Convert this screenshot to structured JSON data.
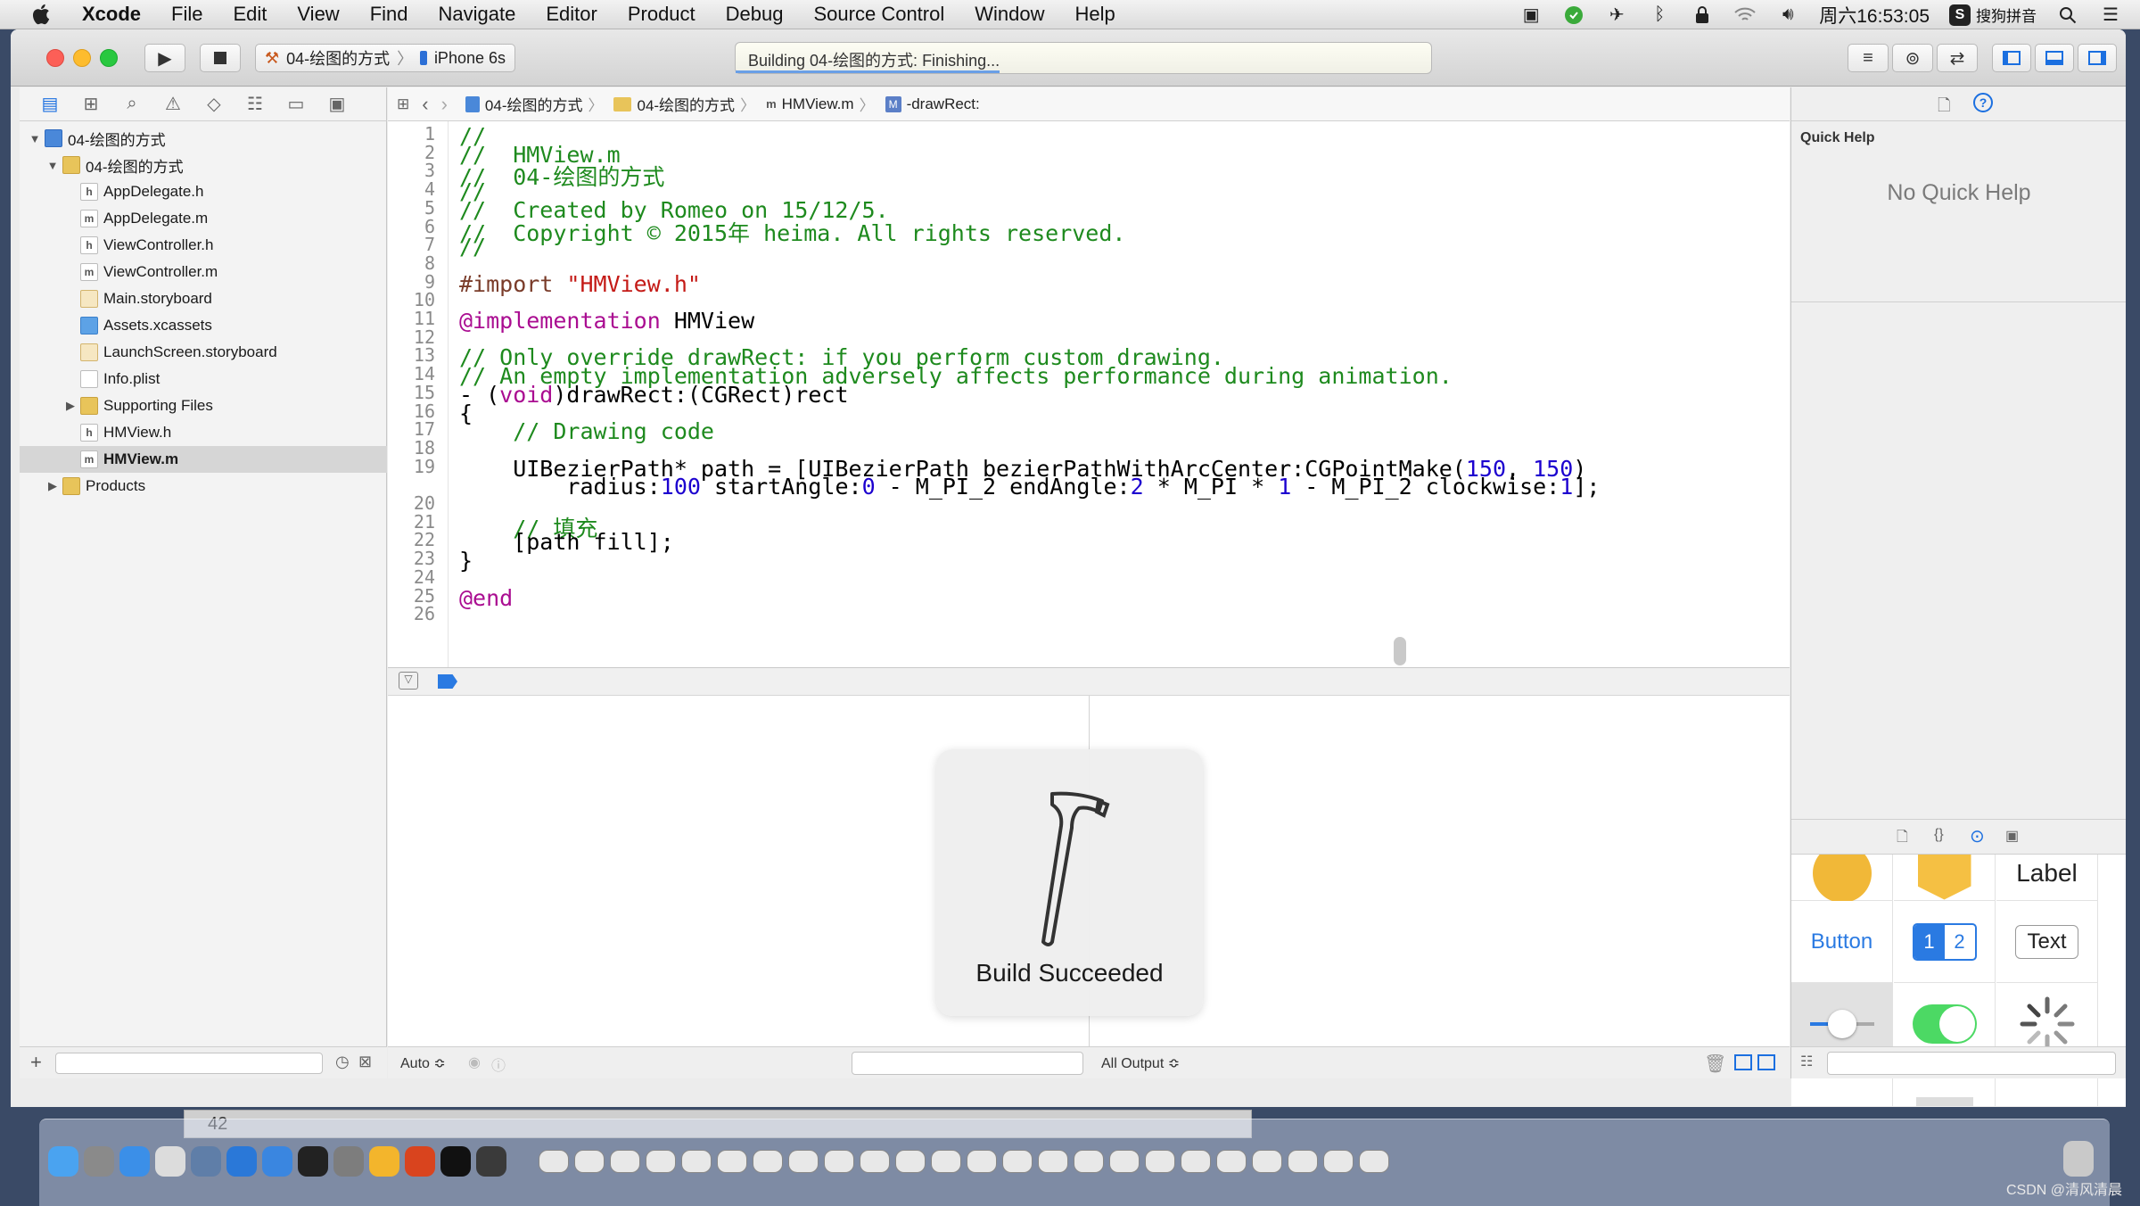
{
  "menubar": {
    "app": "Xcode",
    "items": [
      "File",
      "Edit",
      "View",
      "Find",
      "Navigate",
      "Editor",
      "Product",
      "Debug",
      "Source Control",
      "Window",
      "Help"
    ],
    "clock": "周六16:53:05",
    "input_method": "搜狗拼音"
  },
  "toolbar": {
    "scheme": "04-绘图的方式",
    "device": "iPhone 6s",
    "activity_status": "Building 04-绘图的方式: Finishing...",
    "activity_progress": 0.38
  },
  "navigator": {
    "items": [
      {
        "label": "04-绘图的方式",
        "type": "project",
        "icon": "project-icon",
        "level": 0,
        "expanded": true
      },
      {
        "label": "04-绘图的方式",
        "type": "group",
        "icon": "folder-icon",
        "level": 1,
        "expanded": true
      },
      {
        "label": "AppDelegate.h",
        "type": "file",
        "icon": "h",
        "level": 2
      },
      {
        "label": "AppDelegate.m",
        "type": "file",
        "icon": "m",
        "level": 2
      },
      {
        "label": "ViewController.h",
        "type": "file",
        "icon": "h",
        "level": 2
      },
      {
        "label": "ViewController.m",
        "type": "file",
        "icon": "m",
        "level": 2
      },
      {
        "label": "Main.storyboard",
        "type": "file",
        "icon": "storyboard-icon",
        "level": 2
      },
      {
        "label": "Assets.xcassets",
        "type": "file",
        "icon": "assets-icon",
        "level": 2
      },
      {
        "label": "LaunchScreen.storyboard",
        "type": "file",
        "icon": "storyboard-icon",
        "level": 2
      },
      {
        "label": "Info.plist",
        "type": "file",
        "icon": "plist-icon",
        "level": 2
      },
      {
        "label": "Supporting Files",
        "type": "group",
        "icon": "folder-icon",
        "level": 2,
        "expanded": false
      },
      {
        "label": "HMView.h",
        "type": "file",
        "icon": "h",
        "level": 2
      },
      {
        "label": "HMView.m",
        "type": "file",
        "icon": "m",
        "level": 2,
        "selected": true
      },
      {
        "label": "Products",
        "type": "group",
        "icon": "folder-icon",
        "level": 1,
        "expanded": false
      }
    ]
  },
  "jumpbar": {
    "crumbs": [
      "04-绘图的方式",
      "04-绘图的方式",
      "HMView.m",
      "-drawRect:"
    ]
  },
  "editor": {
    "lines": [
      {
        "n": "1",
        "parts": [
          [
            "c",
            "//"
          ]
        ]
      },
      {
        "n": "2",
        "parts": [
          [
            "c",
            "//  HMView.m"
          ]
        ]
      },
      {
        "n": "3",
        "parts": [
          [
            "c",
            "//  04-绘图的方式"
          ]
        ]
      },
      {
        "n": "4",
        "parts": [
          [
            "c",
            "//"
          ]
        ]
      },
      {
        "n": "5",
        "parts": [
          [
            "c",
            "//  Created by Romeo on 15/12/5."
          ]
        ]
      },
      {
        "n": "6",
        "parts": [
          [
            "c",
            "//  Copyright © 2015年 heima. All rights reserved."
          ]
        ]
      },
      {
        "n": "7",
        "parts": [
          [
            "c",
            "//"
          ]
        ]
      },
      {
        "n": "8",
        "parts": []
      },
      {
        "n": "9",
        "parts": [
          [
            "p",
            "#import "
          ],
          [
            "s",
            "\"HMView.h\""
          ]
        ]
      },
      {
        "n": "10",
        "parts": []
      },
      {
        "n": "11",
        "parts": [
          [
            "k",
            "@implementation"
          ],
          [
            "t",
            " HMView"
          ]
        ]
      },
      {
        "n": "12",
        "parts": []
      },
      {
        "n": "13",
        "parts": [
          [
            "c",
            "// Only override drawRect: if you perform custom drawing."
          ]
        ]
      },
      {
        "n": "14",
        "parts": [
          [
            "c",
            "// An empty implementation adversely affects performance during animation."
          ]
        ]
      },
      {
        "n": "15",
        "parts": [
          [
            "t",
            "- ("
          ],
          [
            "k",
            "void"
          ],
          [
            "t",
            ")drawRect:(CGRect)rect"
          ]
        ]
      },
      {
        "n": "16",
        "parts": [
          [
            "t",
            "{"
          ]
        ]
      },
      {
        "n": "17",
        "parts": [
          [
            "t",
            "    "
          ],
          [
            "c",
            "// Drawing code"
          ]
        ]
      },
      {
        "n": "18",
        "parts": []
      },
      {
        "n": "19",
        "parts": [
          [
            "t",
            "    UIBezierPath* path = [UIBezierPath bezierPathWithArcCenter:CGPointMake("
          ],
          [
            "n",
            "150"
          ],
          [
            "t",
            ", "
          ],
          [
            "n",
            "150"
          ],
          [
            "t",
            ")"
          ]
        ]
      },
      {
        "n": "",
        "parts": [
          [
            "t",
            "        radius:"
          ],
          [
            "n",
            "100"
          ],
          [
            "t",
            " startAngle:"
          ],
          [
            "n",
            "0"
          ],
          [
            "t",
            " - M_PI_2 endAngle:"
          ],
          [
            "n",
            "2"
          ],
          [
            "t",
            " * M_PI * "
          ],
          [
            "n",
            "1"
          ],
          [
            "t",
            " - M_PI_2 clockwise:"
          ],
          [
            "n",
            "1"
          ],
          [
            "t",
            "];"
          ]
        ]
      },
      {
        "n": "20",
        "parts": []
      },
      {
        "n": "21",
        "parts": [
          [
            "t",
            "    "
          ],
          [
            "c",
            "// 填充"
          ]
        ]
      },
      {
        "n": "22",
        "parts": [
          [
            "t",
            "    [path fill];"
          ]
        ]
      },
      {
        "n": "23",
        "parts": [
          [
            "t",
            "}"
          ]
        ]
      },
      {
        "n": "24",
        "parts": []
      },
      {
        "n": "25",
        "parts": [
          [
            "k",
            "@end"
          ]
        ]
      },
      {
        "n": "26",
        "parts": []
      }
    ]
  },
  "console": {
    "auto_label": "Auto ≎",
    "output_label": "All Output ≎"
  },
  "inspector": {
    "quick_help_title": "Quick Help",
    "no_quick_help": "No Quick Help"
  },
  "library": {
    "label_item": "Label",
    "button_item": "Button",
    "segment_1": "1",
    "segment_2": "2",
    "text_item": "Text"
  },
  "hud": {
    "message": "Build Succeeded"
  },
  "statusbar_misc": {
    "dock_counter": "42",
    "watermark": "CSDN @清风清晨"
  },
  "colors": {
    "comment": "#1e8a1e",
    "keyword": "#aa0d91",
    "number": "#1c00cf",
    "string": "#c41a16",
    "preprocessor": "#7a3c2a",
    "accent": "#1b6fe0"
  }
}
